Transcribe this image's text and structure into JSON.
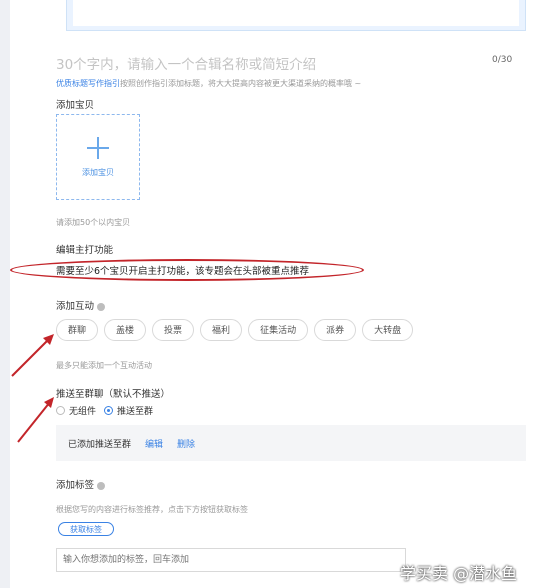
{
  "title_field": {
    "placeholder": "30个字内，请输入一个合辑名称或简短介绍",
    "counter": "0/30"
  },
  "guide": {
    "link": "优质标题写作指引",
    "text": "按照创作指引添加标题，将大大提高内容被更大渠道采纳的概率哦 ~"
  },
  "baby": {
    "label": "添加宝贝",
    "box_label": "添加宝贝",
    "hint": "请添加50个以内宝贝"
  },
  "feature": {
    "label": "编辑主打功能",
    "note": "需要至少6个宝贝开启主打功能，该专题会在头部被重点推荐"
  },
  "interaction": {
    "label": "添加互动",
    "chips": [
      "群聊",
      "盖楼",
      "投票",
      "福利",
      "征集活动",
      "派券",
      "大转盘"
    ],
    "hint": "最多只能添加一个互动活动"
  },
  "push": {
    "label": "推送至群聊（默认不推送）",
    "options": [
      {
        "label": "无组件",
        "checked": false
      },
      {
        "label": "推送至群",
        "checked": true
      }
    ],
    "panel": {
      "added": "已添加推送至群",
      "edit": "编辑",
      "delete": "删除"
    }
  },
  "tags": {
    "label": "添加标签",
    "hint": "根据您写的内容进行标签推荐，点击下方按钮获取标签",
    "fetch_button": "获取标签",
    "input_placeholder": "输入你想添加的标签，回车添加"
  },
  "watermark": "学买卖 @潜水鱼",
  "colors": {
    "accent": "#3a82e4",
    "annotation_red": "#c3252a"
  }
}
